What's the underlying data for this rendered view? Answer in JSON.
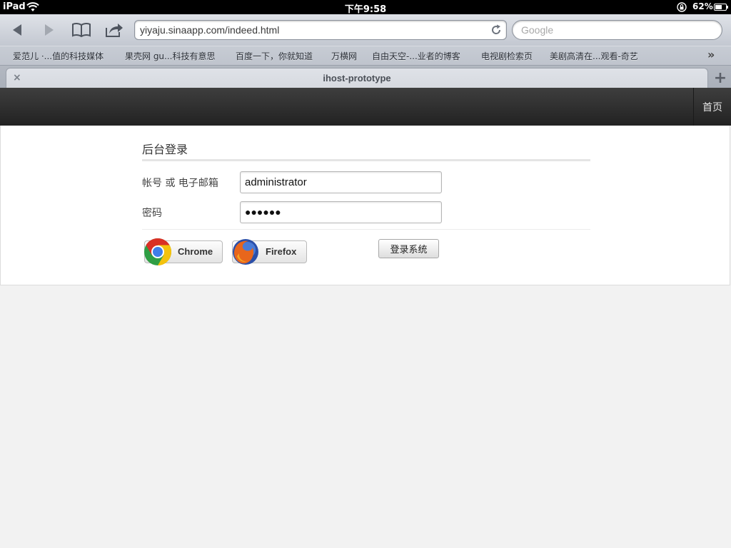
{
  "status_bar": {
    "device": "iPad",
    "time": "下午9:58",
    "battery_percent": "62%",
    "battery_level": 0.62
  },
  "toolbar": {
    "url": "yiyaju.sinaapp.com/indeed.html",
    "search_placeholder": "Google"
  },
  "bookmarks": [
    "爱范儿 ·...值的科技媒体",
    "果壳网 gu...科技有意思",
    "百度一下，你就知道",
    "万横网",
    "自由天空-...业者的博客",
    "电视剧检索页",
    "美剧高清在...观看-奇艺"
  ],
  "bookmarks_more": "»",
  "tab": {
    "close": "×",
    "title": "ihost-prototype",
    "new_tab": "+"
  },
  "navbar": {
    "home": "首页"
  },
  "login": {
    "legend": "后台登录",
    "username_label": "帐号 或 电子邮箱",
    "username_value": "administrator",
    "password_label": "密码",
    "password_value": "●●●●●●",
    "chrome_label": "Chrome",
    "firefox_label": "Firefox",
    "submit_label": "登录系统"
  },
  "colors": {
    "navbar": "#2d2d2d",
    "page_bg": "#f2f2f2",
    "card_bg": "#ffffff"
  }
}
